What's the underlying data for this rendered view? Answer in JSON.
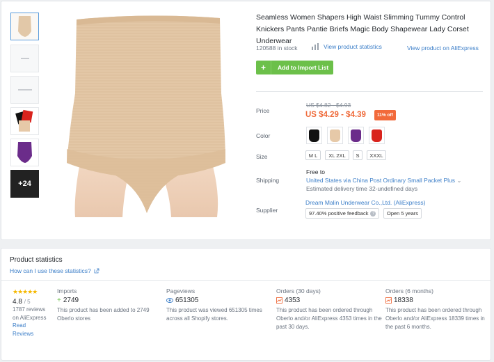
{
  "product": {
    "title": "Seamless Women Shapers High Waist Slimming Tummy Control Knickers Pants Pantie Briefs Magic Body Shapewear Lady Corset Underwear",
    "stock": "120588 in stock",
    "view_stats_label": "View product statistics",
    "view_ali_label": "View product on AliExpress",
    "import_label": "Add to Import List",
    "thumb_more": "+24"
  },
  "price": {
    "label": "Price",
    "old": "US $4.82 - $4.93",
    "current": "US $4.29 - $4.39",
    "discount": "11% off"
  },
  "color": {
    "label": "Color",
    "swatches": [
      "#111111",
      "#e6c9a8",
      "#6b2c8a",
      "#d9231d"
    ]
  },
  "size": {
    "label": "Size",
    "options": [
      "M L",
      "XL 2XL",
      "S",
      "XXXL"
    ]
  },
  "shipping": {
    "label": "Shipping",
    "free_to": "Free to",
    "method": "United States via China Post Ordinary Small Packet Plus",
    "estimate": "Estimated delivery time 32-undefined days"
  },
  "supplier": {
    "label": "Supplier",
    "name": "Dream Malin Underwear Co.,Ltd. (AliExpress)",
    "feedback": "97.40% positive feedback",
    "open": "Open 5 years"
  },
  "stats": {
    "title": "Product statistics",
    "help": "How can I use these statistics?",
    "rating": {
      "stars": "★★★★★",
      "value": "4.8",
      "of": "/ 5",
      "reviews_text": "1787 reviews on AliExpress",
      "read_label": "Read Reviews"
    },
    "imports": {
      "label": "Imports",
      "value": "2749",
      "desc": "This product has been added to 2749 Oberlo stores"
    },
    "pageviews": {
      "label": "Pageviews",
      "value": "651305",
      "desc": "This product was viewed 651305 times across all Shopify stores."
    },
    "orders30": {
      "label": "Orders (30 days)",
      "value": "4353",
      "desc": "This product has been ordered through Oberlo and/or AliExpress 4353 times in the past 30 days."
    },
    "orders6": {
      "label": "Orders (6 months)",
      "value": "18338",
      "desc": "This product has been ordered through Oberlo and/or AliExpress 18339 times in the past 6 months."
    }
  },
  "colors": {
    "accent": "#3b7ec8",
    "green": "#6cc04a",
    "price": "#ef6b3b"
  }
}
